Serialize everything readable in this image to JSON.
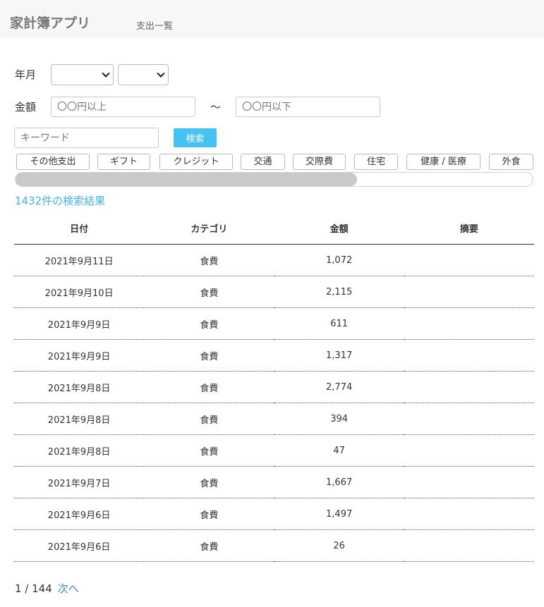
{
  "header": {
    "title": "家計簿アプリ",
    "nav_link": "支出一覧"
  },
  "filters": {
    "year_month_label": "年月",
    "year_value": "",
    "month_value": "",
    "amount_label": "金額",
    "amount_min_placeholder": "〇〇円以上",
    "amount_tilde": "〜",
    "amount_max_placeholder": "〇〇円以下",
    "keyword_placeholder": "キーワード",
    "search_button": "検索"
  },
  "categories": [
    "その他支出",
    "ギフト",
    "クレジット",
    "交通",
    "交際費",
    "住宅",
    "健康 / 医療",
    "外食"
  ],
  "category_scroll_position": 0.66,
  "results": {
    "count_text": "1432件の検索結果"
  },
  "table": {
    "headers": [
      "日付",
      "カテゴリ",
      "金額",
      "摘要"
    ],
    "rows": [
      [
        "2021年9月11日",
        "食費",
        "1,072",
        ""
      ],
      [
        "2021年9月10日",
        "食費",
        "2,115",
        ""
      ],
      [
        "2021年9月9日",
        "食費",
        "611",
        ""
      ],
      [
        "2021年9月9日",
        "食費",
        "1,317",
        ""
      ],
      [
        "2021年9月8日",
        "食費",
        "2,774",
        ""
      ],
      [
        "2021年9月8日",
        "食費",
        "394",
        ""
      ],
      [
        "2021年9月8日",
        "食費",
        "47",
        ""
      ],
      [
        "2021年9月7日",
        "食費",
        "1,667",
        ""
      ],
      [
        "2021年9月6日",
        "食費",
        "1,497",
        ""
      ],
      [
        "2021年9月6日",
        "食費",
        "26",
        ""
      ]
    ]
  },
  "pager": {
    "page_text": "1 / 144",
    "next_label": "次へ"
  },
  "colors": {
    "accent": "#44c2f1",
    "link": "#3a8cc2",
    "result_text": "#44b4de"
  }
}
